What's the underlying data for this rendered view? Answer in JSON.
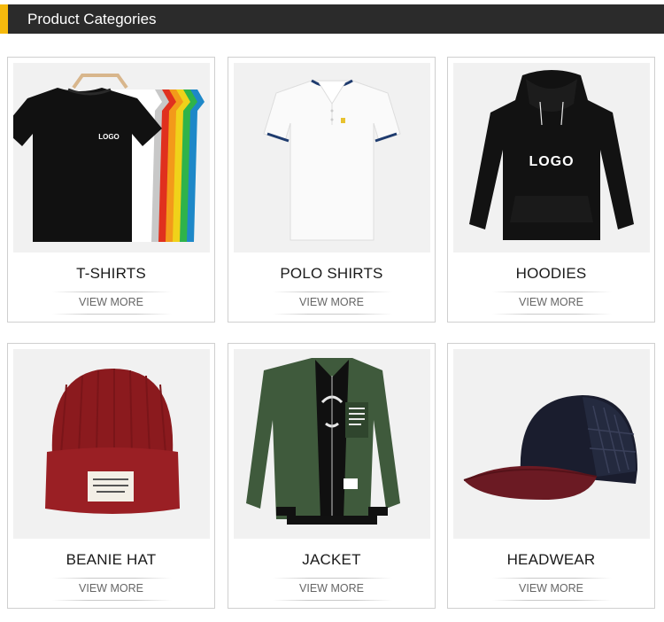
{
  "header": {
    "title": "Product Categories"
  },
  "categories": [
    {
      "name": "T-SHIRTS",
      "more": "VIEW MORE",
      "logo": "LOGO"
    },
    {
      "name": "POLO SHIRTS",
      "more": "VIEW MORE"
    },
    {
      "name": "HOODIES",
      "more": "VIEW MORE",
      "logo": "LOGO"
    },
    {
      "name": "BEANIE HAT",
      "more": "VIEW MORE"
    },
    {
      "name": "JACKET",
      "more": "VIEW MORE"
    },
    {
      "name": "HEADWEAR",
      "more": "VIEW MORE"
    }
  ],
  "colors": {
    "accent": "#f5b90d",
    "header_bg": "#2b2b2b"
  }
}
